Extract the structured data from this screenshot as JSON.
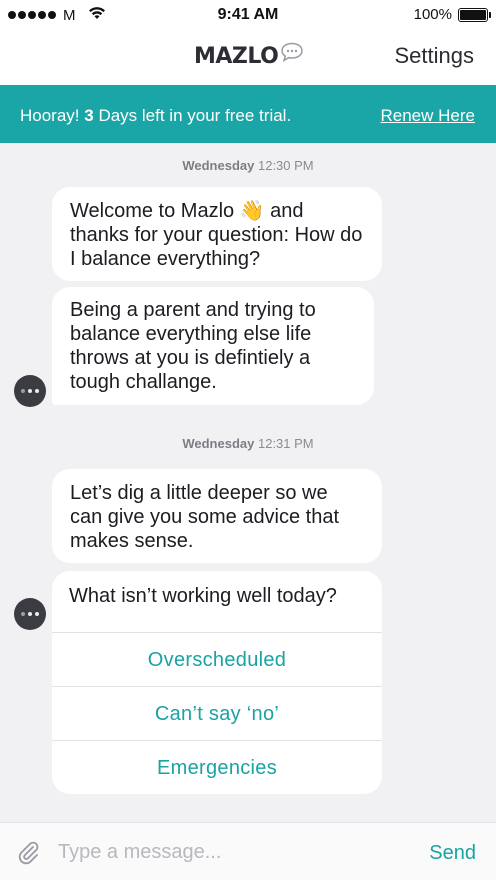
{
  "status_bar": {
    "carrier": "M",
    "time": "9:41 AM",
    "battery": "100%"
  },
  "nav": {
    "logo": "MAZLO",
    "settings_label": "Settings"
  },
  "banner": {
    "prefix": "Hooray! ",
    "days": "3",
    "suffix": " Days left in your free trial.",
    "renew_label": "Renew Here"
  },
  "chat": {
    "groups": [
      {
        "day": "Wednesday",
        "time": "12:30 PM",
        "messages": [
          "Welcome to Mazlo 👋 and thanks for your question: How do I balance everything?",
          "Being a parent and trying to balance everything else life throws at you is defintiely a tough challange."
        ]
      },
      {
        "day": "Wednesday",
        "time": "12:31 PM",
        "messages": [
          "Let’s dig a little deeper so we can give you some advice that makes sense."
        ],
        "question": "What isn’t working well today?",
        "options": [
          "Overscheduled",
          "Can’t say ‘no’",
          "Emergencies"
        ]
      }
    ]
  },
  "composer": {
    "placeholder": "Type a message...",
    "send_label": "Send"
  },
  "colors": {
    "accent": "#1aa6a6",
    "background": "#f1f1f4"
  },
  "icons": [
    "wifi-icon",
    "battery-icon",
    "chat-bubble-icon",
    "paperclip-icon",
    "bot-avatar-icon"
  ]
}
